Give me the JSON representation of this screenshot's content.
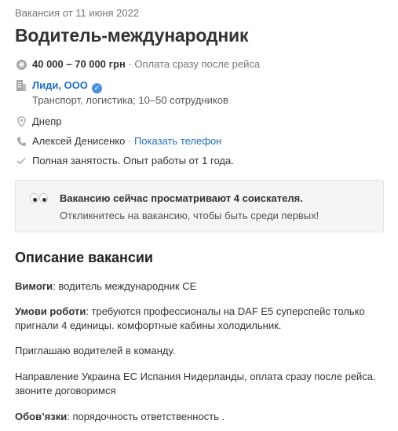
{
  "vacancy": {
    "date": "Вакансия от 11 июня 2022",
    "title": "Водитель-международник",
    "salary": {
      "amount": "40 000 – 70 000 грн",
      "note": "Оплата сразу после рейса"
    },
    "company": {
      "name": "Лиди, ООО",
      "details": "Транспорт, логистика; 10–50 сотрудников",
      "verified": true
    },
    "city": "Днепр",
    "contact": {
      "name": "Алексей Денисенко",
      "show_phone": "Показать телефон"
    },
    "employment": "Полная занятость. Опыт работы от 1 года."
  },
  "alert": {
    "title": "Вакансию сейчас просматривают 4 соискателя.",
    "subtitle": "Откликнитесь на вакансию, чтобы быть среди первых!"
  },
  "description": {
    "heading": "Описание вакансии",
    "requirements": {
      "label": "Вимоги",
      "text": ": водитель международник СЕ"
    },
    "conditions": {
      "label": "Умови роботи",
      "text": ": требуются профессионалы на DAF E5 суперспейс только пригнали 4 единицы. комфортные кабины холодильник."
    },
    "invite": "Приглашаю водителей в команду.",
    "direction": "Направление Украина ЕС Испания Нидерланды, оплата сразу после рейса. звоните договоримся",
    "duties": {
      "label": "Обов’язки",
      "text": ": порядочность ответственность ."
    }
  },
  "icons": {
    "salary": "hryvnia-coin-icon",
    "company": "building-icon",
    "location": "map-pin-icon",
    "phone": "phone-icon",
    "check": "check-icon",
    "verified": "verified-badge-icon",
    "eyes": "eyes-emoji-icon"
  },
  "colors": {
    "link": "#1e6ec0",
    "verified": "#4a90e2",
    "alert_bg": "#f5f5f5"
  }
}
